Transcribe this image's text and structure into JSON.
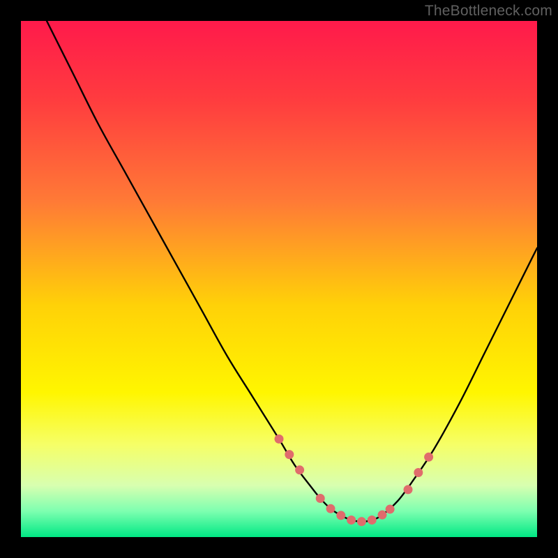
{
  "watermark": "TheBottleneck.com",
  "colors": {
    "bg": "#000000",
    "curve": "#000000",
    "marker_fill": "#e06c6c",
    "marker_stroke": "#d85a5a"
  },
  "chart_data": {
    "type": "line",
    "title": "",
    "xlabel": "",
    "ylabel": "",
    "xlim": [
      0,
      100
    ],
    "ylim": [
      0,
      100
    ],
    "grid": false,
    "gradient_stops": [
      {
        "offset": 0.0,
        "color": "#ff1a4b"
      },
      {
        "offset": 0.15,
        "color": "#ff3b3f"
      },
      {
        "offset": 0.35,
        "color": "#ff7a36"
      },
      {
        "offset": 0.55,
        "color": "#ffd108"
      },
      {
        "offset": 0.72,
        "color": "#fff600"
      },
      {
        "offset": 0.82,
        "color": "#f6ff66"
      },
      {
        "offset": 0.9,
        "color": "#d8ffb0"
      },
      {
        "offset": 0.95,
        "color": "#7dffb0"
      },
      {
        "offset": 1.0,
        "color": "#00e884"
      }
    ],
    "series": [
      {
        "name": "bottleneck-curve",
        "x": [
          5,
          10,
          15,
          20,
          25,
          30,
          35,
          40,
          45,
          50,
          53,
          56,
          58,
          60,
          62,
          64,
          66,
          68,
          70,
          73,
          76,
          80,
          85,
          90,
          95,
          100
        ],
        "y": [
          100,
          90,
          80,
          71,
          62,
          53,
          44,
          35,
          27,
          19,
          14,
          10,
          7.5,
          5.5,
          4.2,
          3.3,
          3.0,
          3.3,
          4.3,
          7.0,
          11,
          17,
          26,
          36,
          46,
          56
        ]
      }
    ],
    "markers": {
      "name": "highlight-points",
      "x": [
        50,
        52,
        54,
        58,
        60,
        62,
        64,
        66,
        68,
        70,
        71.5,
        75,
        77,
        79
      ],
      "y": [
        19,
        16,
        13,
        7.5,
        5.5,
        4.2,
        3.3,
        3.0,
        3.3,
        4.3,
        5.4,
        9.2,
        12.5,
        15.5
      ],
      "r": 6.5
    }
  }
}
